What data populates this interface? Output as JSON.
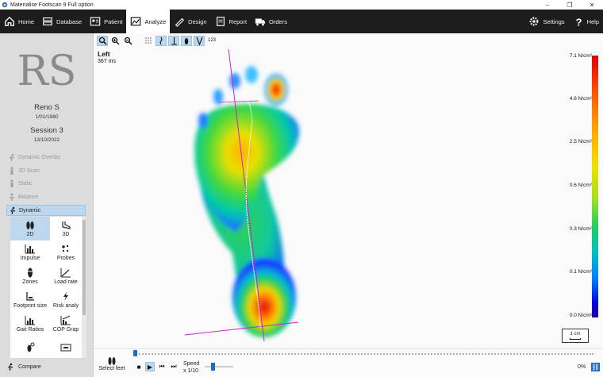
{
  "window": {
    "title": "Materialise Footscan 9 Full option",
    "controls": [
      "–",
      "❐",
      "✕"
    ]
  },
  "nav": {
    "items": [
      {
        "label": "Home",
        "icon": "home-icon"
      },
      {
        "label": "Database",
        "icon": "database-icon"
      },
      {
        "label": "Patient",
        "icon": "patient-icon"
      },
      {
        "label": "Analyze",
        "icon": "analyze-icon",
        "active": true
      },
      {
        "label": "Design",
        "icon": "design-icon"
      },
      {
        "label": "Report",
        "icon": "report-icon"
      },
      {
        "label": "Orders",
        "icon": "orders-icon"
      }
    ],
    "settings": "Settings",
    "help": "Help"
  },
  "patient": {
    "initials": "RS",
    "name": "Reno S",
    "dob": "1/01/1980",
    "session": "Session 3",
    "session_date": "13/10/2022"
  },
  "menu": {
    "items": [
      {
        "label": "Dynamic Overlay",
        "icon": "dynamic-overlay-icon"
      },
      {
        "label": "3D Scan",
        "icon": "3d-scan-icon"
      },
      {
        "label": "Static",
        "icon": "static-icon"
      },
      {
        "label": "Balance",
        "icon": "balance-icon"
      },
      {
        "label": "Dynamic",
        "icon": "dynamic-icon",
        "selected": true
      }
    ],
    "compare": "Compare"
  },
  "tools": [
    {
      "label": "2D",
      "icon": "feet-2d-icon",
      "selected": true
    },
    {
      "label": "3D",
      "icon": "foot-3d-icon"
    },
    {
      "label": "Impulse",
      "icon": "impulse-icon"
    },
    {
      "label": "Probes",
      "icon": "probes-icon"
    },
    {
      "label": "Zones",
      "icon": "zones-icon"
    },
    {
      "label": "Load rate",
      "icon": "load-rate-icon"
    },
    {
      "label": "Footprint size",
      "icon": "footprint-size-icon"
    },
    {
      "label": "Risk analy",
      "icon": "risk-analysis-icon"
    },
    {
      "label": "Gait Ratios",
      "icon": "gait-ratios-icon"
    },
    {
      "label": "COP Grap",
      "icon": "cop-graph-icon"
    },
    {
      "label": "",
      "icon": "timer-foot-icon"
    },
    {
      "label": "",
      "icon": "shoe-icon"
    }
  ],
  "view": {
    "foot": "Left",
    "time": "367 ms",
    "toolbar_text": "123",
    "scale_label": "1 cm",
    "colorbar_labels": [
      "7.1 N/cm²",
      "4.6 N/cm²",
      "2.5 N/cm²",
      "0.6 N/cm²",
      "0.3 N/cm²",
      "0.1 N/cm²",
      "0.0 N/cm²"
    ],
    "colorbar_colors": [
      "#e00000",
      "#ff5a00",
      "#ffb000",
      "#f0e000",
      "#20d060",
      "#0080ff",
      "#2a00a0"
    ]
  },
  "playback": {
    "select_feet": "Select feet",
    "speed_label": "Speed",
    "speed_value": "x 1/10",
    "speed_level": 0.25,
    "timeline_position": 0,
    "percent": "0%"
  }
}
